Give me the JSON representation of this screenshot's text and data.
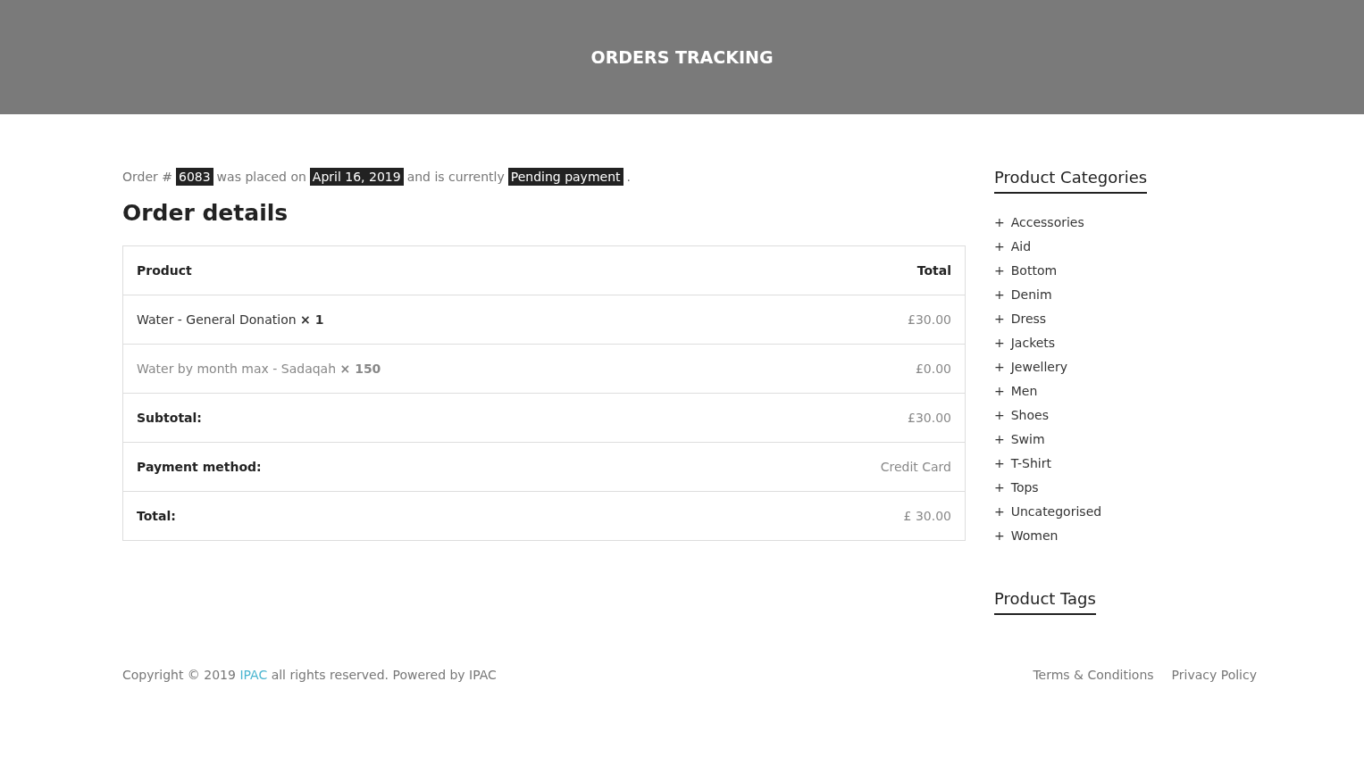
{
  "banner": {
    "title": "ORDERS TRACKING"
  },
  "order_summary": [
    {
      "text": "Order #",
      "highlighted": false
    },
    {
      "text": "6083",
      "highlighted": true
    },
    {
      "text": "was placed on",
      "highlighted": false
    },
    {
      "text": "April 16, 2019",
      "highlighted": true
    },
    {
      "text": "and is currently",
      "highlighted": false
    },
    {
      "text": "Pending payment",
      "highlighted": true
    },
    {
      "text": ".",
      "highlighted": false
    }
  ],
  "order_details": {
    "title": "Order details",
    "columns": [
      "Product",
      "Total"
    ],
    "items": [
      {
        "name": "Water - General Donation **× 1**",
        "total": "£30.00",
        "linked": true
      },
      {
        "name": "Water by month max - Sadaqah **× 150**",
        "total": "£0.00",
        "linked": false
      }
    ],
    "totals": [
      {
        "label": "Subtotal:",
        "value": "£30.00"
      },
      {
        "label": "Payment method:",
        "value": "Credit Card"
      },
      {
        "label": "Total:",
        "value": "£ 30.00"
      }
    ]
  },
  "sidebar": {
    "categories_title": "Product Categories",
    "categories": [
      {
        "marker": "+",
        "label": "Accessories"
      },
      {
        "marker": "+",
        "label": "Aid"
      },
      {
        "marker": "+",
        "label": "Bottom"
      },
      {
        "marker": "+",
        "label": "Denim"
      },
      {
        "marker": "+",
        "label": "Dress"
      },
      {
        "marker": "+",
        "label": "Jackets"
      },
      {
        "marker": "+",
        "label": "Jewellery"
      },
      {
        "marker": "+",
        "label": "Men"
      },
      {
        "marker": "+",
        "label": "Shoes"
      },
      {
        "marker": "+",
        "label": "Swim"
      },
      {
        "marker": "+",
        "label": "T-Shirt"
      },
      {
        "marker": "+",
        "label": "Tops"
      },
      {
        "marker": "+",
        "label": "Uncategorised"
      },
      {
        "marker": "+",
        "label": "Women"
      }
    ],
    "tags_title": "Product Tags"
  },
  "footer": {
    "copyright_prefix": "Copyright © 2019",
    "copyright_link": "IPAC",
    "copyright_suffix": "all rights reserved. Powered by IPAC",
    "links": [
      "Terms & Conditions",
      "Privacy Policy"
    ]
  }
}
